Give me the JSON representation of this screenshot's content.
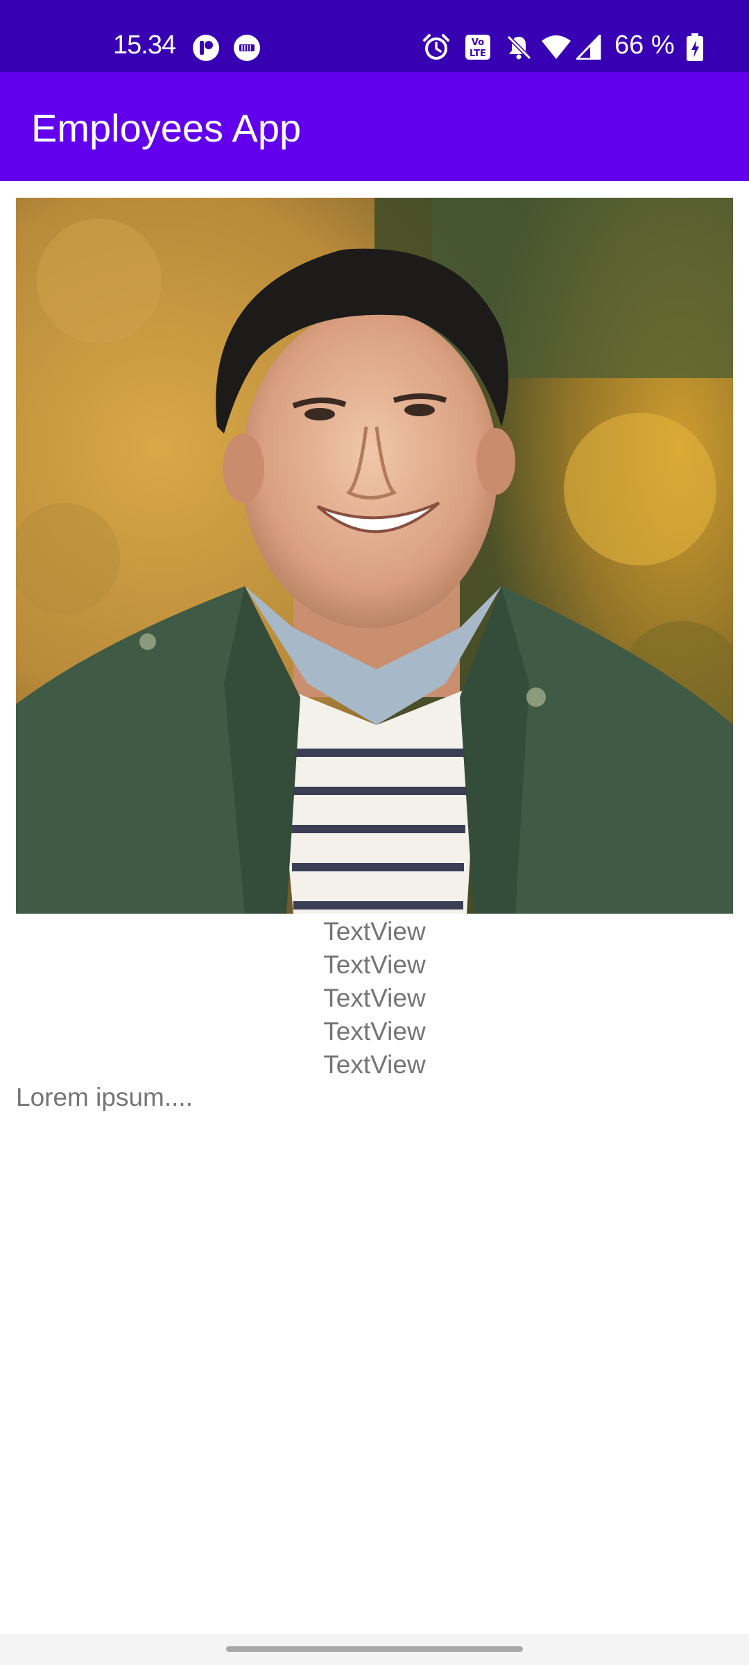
{
  "status_bar": {
    "time": "15.34",
    "battery": "66 %",
    "icons": [
      "notification-app-icon",
      "notification-app-icon-2",
      "alarm-icon",
      "volte-icon",
      "silent-icon",
      "wifi-icon",
      "signal-icon",
      "battery-icon"
    ]
  },
  "app_bar": {
    "title": "Employees App"
  },
  "employee": {
    "photo": "employee-photo",
    "fields": [
      "TextView",
      "TextView",
      "TextView",
      "TextView",
      "TextView"
    ],
    "description": "Lorem ipsum...."
  },
  "colors": {
    "status_bar": "#3700b3",
    "app_bar": "#6200ee",
    "text": "#757575"
  }
}
